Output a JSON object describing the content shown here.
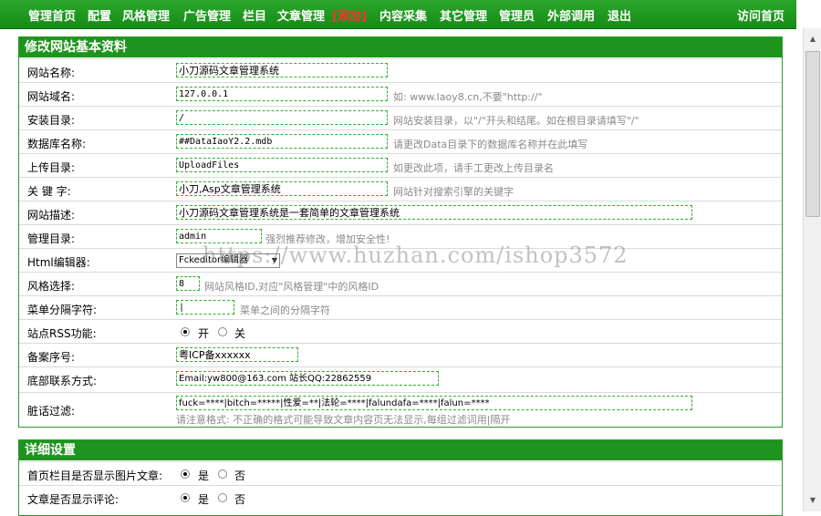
{
  "nav": {
    "items": [
      "管理首页",
      "配置",
      "风格管理",
      "广告管理",
      "栏目",
      "文章管理",
      "[添加]",
      "内容采集",
      "其它管理",
      "管理员",
      "外部调用",
      "退出"
    ],
    "visit_home": "访问首页"
  },
  "basic": {
    "title": "修改网站基本资料",
    "site_name_label": "网站名称:",
    "site_name_value": "小刀源码文章管理系统",
    "domain_label": "网站域名:",
    "domain_value": "127.0.0.1",
    "domain_hint": "如: www.laoy8.cn,不要\"http://\"",
    "install_dir_label": "安装目录:",
    "install_dir_value": "/",
    "install_dir_hint": "网站安装目录，以\"/\"开头和结尾。如在根目录请填写\"/\"",
    "db_name_label": "数据库名称:",
    "db_name_value": "##DataIaoY2.2.mdb",
    "db_name_hint": "请更改Data目录下的数据库名称并在此填写",
    "upload_dir_label": "上传目录:",
    "upload_dir_value": "UploadFiles",
    "upload_dir_hint": "如更改此项，请手工更改上传目录名",
    "keywords_label": "关 键 字:",
    "keywords_value": "小刀,Asp文章管理系统",
    "keywords_hint": "网站针对搜索引擎的关键字",
    "desc_label": "网站描述:",
    "desc_value": "小刀源码文章管理系统是一套简单的文章管理系统",
    "admin_dir_label": "管理目录:",
    "admin_dir_value": "admin",
    "admin_dir_hint": "强烈推荐修改，增加安全性!",
    "editor_label": "Html编辑器:",
    "editor_value": "Fckeditor编辑器",
    "style_label": "风格选择:",
    "style_value": "8",
    "style_hint": "网站风格ID,对应\"风格管理\"中的风格ID",
    "menu_sep_label": "菜单分隔字符:",
    "menu_sep_value": "|",
    "menu_sep_hint": "菜单之间的分隔字符",
    "rss_label": "站点RSS功能:",
    "rss_on": "开",
    "rss_off": "关",
    "icp_label": "备案序号:",
    "icp_value": "粤ICP备xxxxxx",
    "footer_label": "底部联系方式:",
    "footer_value": "Email:yw800@163.com 站长QQ:22862559",
    "filter_label": "脏话过滤:",
    "filter_value": "fuck=****|bitch=*****|性爱=**|法轮=****|falundafa=****|falun=****",
    "filter_hint": "请注意格式: 不正确的格式可能导致文章内容页无法显示,每组过滤词用|隔开"
  },
  "detail": {
    "title": "详细设置",
    "home_img_label": "首页栏目是否显示图片文章:",
    "home_img_yes": "是",
    "home_img_no": "否",
    "comment_label": "文章是否显示评论:",
    "comment_yes": "是",
    "comment_no": "否"
  },
  "watermark": "https://www.huzhan.com/ishop3572",
  "colors": {
    "nav_bg": "#1e941e",
    "panel_head": "#1e941e",
    "field_border": "#2bb52b",
    "hint": "#8a8a8a",
    "nav_highlight": "#ff3030"
  }
}
